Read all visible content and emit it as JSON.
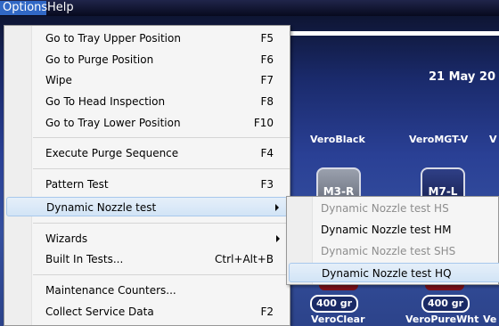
{
  "menubar": {
    "options_label": "Options",
    "help_label": "Help"
  },
  "background": {
    "date": "21 May 20",
    "cartridges_top": [
      {
        "label": "VeroBlack",
        "slot": "M3-R"
      },
      {
        "label": "VeroMGT-V",
        "slot": "M7-L"
      },
      {
        "label": "V"
      }
    ],
    "weights": [
      "400 gr",
      "400 gr"
    ],
    "cartridges_bottom": [
      "VeroClear",
      "VeroPureWht",
      "Ve"
    ]
  },
  "options_menu": {
    "items": [
      {
        "label": "Go to Tray Upper Position",
        "shortcut": "F5"
      },
      {
        "label": "Go to Purge Position",
        "shortcut": "F6"
      },
      {
        "label": "Wipe",
        "shortcut": "F7"
      },
      {
        "label": "Go To Head Inspection",
        "shortcut": "F8"
      },
      {
        "label": "Go to Tray Lower Position",
        "shortcut": "F10"
      },
      {
        "label": "Execute Purge Sequence",
        "shortcut": "F4"
      },
      {
        "label": "Pattern Test",
        "shortcut": "F3"
      },
      {
        "label": "Dynamic Nozzle test",
        "shortcut": ""
      },
      {
        "label": "Wizards",
        "shortcut": ""
      },
      {
        "label": "Built In Tests...",
        "shortcut": "Ctrl+Alt+B"
      },
      {
        "label": "Maintenance Counters...",
        "shortcut": ""
      },
      {
        "label": "Collect Service Data",
        "shortcut": "F2"
      }
    ]
  },
  "submenu": {
    "items": [
      {
        "label": "Dynamic Nozzle test HS",
        "enabled": false
      },
      {
        "label": "Dynamic Nozzle test HM",
        "enabled": true
      },
      {
        "label": "Dynamic Nozzle test SHS",
        "enabled": false
      },
      {
        "label": "Dynamic Nozzle test HQ",
        "enabled": true
      }
    ]
  },
  "colors": {
    "highlight": "#d2e4f6",
    "menu_bg": "#f5f5f5",
    "active_menubar": "#3168c5"
  }
}
